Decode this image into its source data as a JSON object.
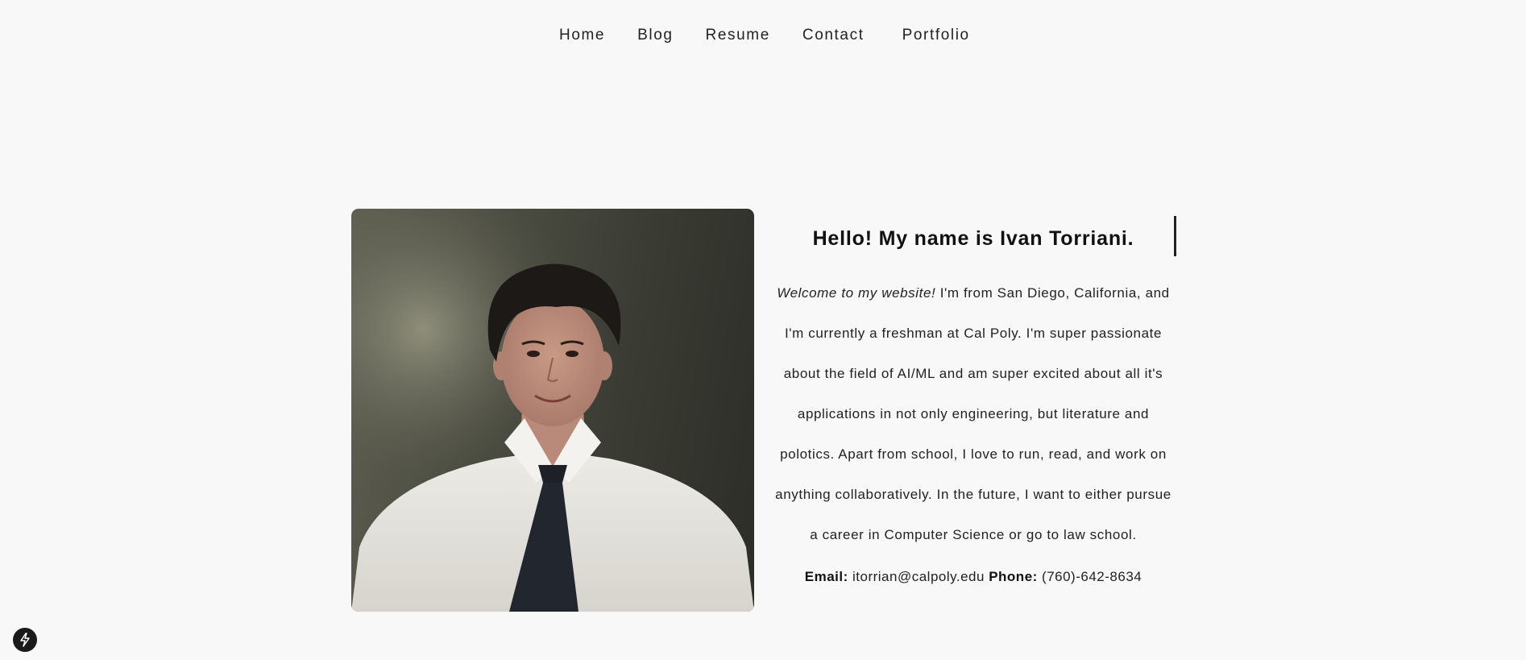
{
  "nav": {
    "links": [
      "Home",
      "Blog",
      "Resume",
      "Contact",
      "Portfolio"
    ]
  },
  "profile": {
    "photo_alt": "Ivan Torriani",
    "title": "Hello! My name is Ivan Torriani.",
    "intro_italic": "Welcome to my website!",
    "intro_rest": " I'm from San Diego, California, and I'm currently a freshman at Cal Poly. I'm super passionate about the field of AI/ML and am super excited about all it's applications in not only engineering, but literature and polotics. Apart from school, I love to run, read, and work on anything collaboratively. In the future, I want to either pursue a career in Computer Science or go to law school.",
    "email_label": "Email:",
    "email_value": " itorrian@calpoly.edu ",
    "phone_label": "Phone:",
    "phone_value": " (760)-642-8634"
  },
  "colors": {
    "background": "#f8f8f8",
    "text": "#222222",
    "badge": "#1a1a1a"
  },
  "icons": {
    "badge_icon": "lightning-bolt-icon"
  }
}
